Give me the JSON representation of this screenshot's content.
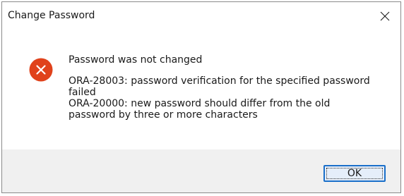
{
  "window": {
    "title": "Change Password",
    "close_icon": "close-icon"
  },
  "dialog": {
    "icon": "error-icon",
    "icon_color": "#e0421b",
    "message_lines": [
      "Password was not changed",
      "ORA-28003: password verification for the specified password",
      "failed",
      "ORA-20000: new password should differ from the old",
      "password by three or more characters"
    ]
  },
  "buttons": {
    "ok_label": "OK",
    "accent_color": "#1a6fc9"
  }
}
